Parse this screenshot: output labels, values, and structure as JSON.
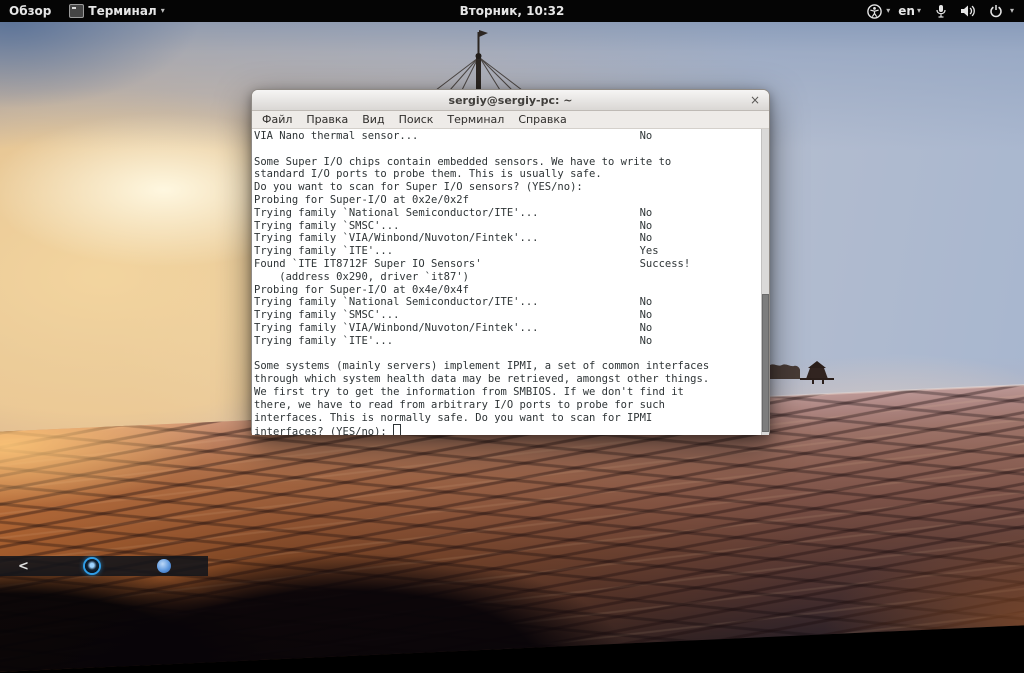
{
  "top_bar": {
    "activities": "Обзор",
    "app_menu_label": "Терминал",
    "caret": "▾",
    "clock": "Вторник, 10:32",
    "language": "en"
  },
  "window": {
    "title": "sergiy@sergiy-pc: ~",
    "close_label": "×",
    "menu": [
      "Файл",
      "Правка",
      "Вид",
      "Поиск",
      "Терминал",
      "Справка"
    ]
  },
  "terminal": {
    "text": "VIA Nano thermal sensor...                                   No\n\nSome Super I/O chips contain embedded sensors. We have to write to\nstandard I/O ports to probe them. This is usually safe.\nDo you want to scan for Super I/O sensors? (YES/no): \nProbing for Super-I/O at 0x2e/0x2f\nTrying family `National Semiconductor/ITE'...                No\nTrying family `SMSC'...                                      No\nTrying family `VIA/Winbond/Nuvoton/Fintek'...                No\nTrying family `ITE'...                                       Yes\nFound `ITE IT8712F Super IO Sensors'                         Success!\n    (address 0x290, driver `it87')\nProbing for Super-I/O at 0x4e/0x4f\nTrying family `National Semiconductor/ITE'...                No\nTrying family `SMSC'...                                      No\nTrying family `VIA/Winbond/Nuvoton/Fintek'...                No\nTrying family `ITE'...                                       No\n\nSome systems (mainly servers) implement IPMI, a set of common interfaces\nthrough which system health data may be retrieved, amongst other things.\nWe first try to get the information from SMBIOS. If we don't find it\nthere, we have to read from arbitrary I/O ports to probe for such\ninterfaces. This is normally safe. Do you want to scan for IPMI\ninterfaces? (YES/no): "
  },
  "dock": {
    "back_chevron": "<"
  },
  "colors": {
    "topbar_bg": "#050505",
    "terminal_fg": "#2e3436",
    "sunset_orange": "#e09a55",
    "dock_ring_blue": "#2f9de6"
  }
}
